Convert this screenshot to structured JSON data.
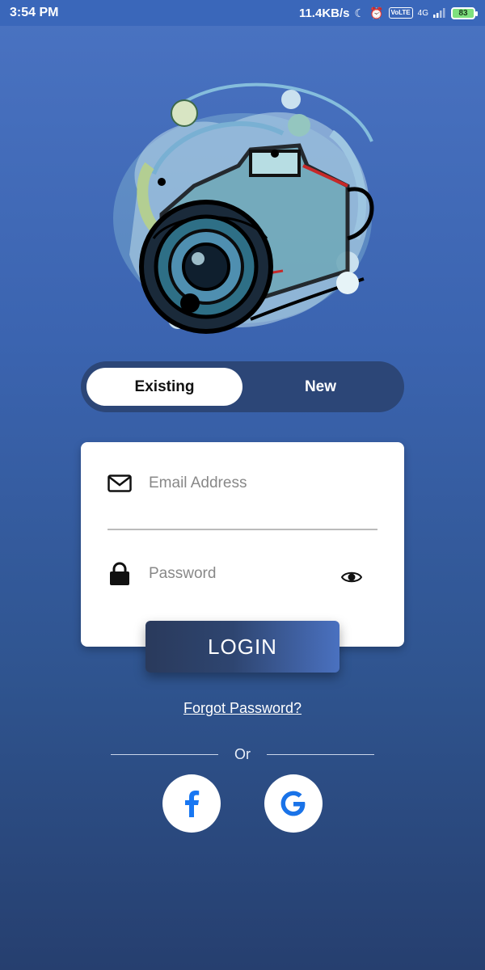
{
  "status_bar": {
    "time": "3:54 PM",
    "network_speed": "11.4KB/s",
    "network_type": "4G",
    "volte": "VoLTE",
    "battery_level": "83",
    "icons": [
      "moon-icon",
      "alarm-icon",
      "volte-icon",
      "signal-icon",
      "battery-icon"
    ]
  },
  "hero": {
    "icon": "camera-illustration"
  },
  "auth_toggle": {
    "existing_label": "Existing",
    "new_label": "New",
    "selected": "Existing"
  },
  "form": {
    "email": {
      "placeholder": "Email Address",
      "value": "",
      "icon": "mail-icon"
    },
    "password": {
      "placeholder": "Password",
      "value": "",
      "icon": "lock-icon",
      "toggle_icon": "eye-icon"
    }
  },
  "login_label": "LOGIN",
  "forgot_label": "Forgot Password?",
  "or_label": "Or",
  "social": [
    {
      "name": "facebook",
      "icon": "facebook-icon",
      "color": "#1877f2"
    },
    {
      "name": "google",
      "icon": "google-icon",
      "color": "#1a73e8"
    }
  ],
  "colors": {
    "background_top": "#4a73c2",
    "background_bottom": "#263f6f",
    "toggle_track": "#2c4677",
    "button_dark": "#2a3a5c",
    "button_light": "#4a71c0"
  }
}
